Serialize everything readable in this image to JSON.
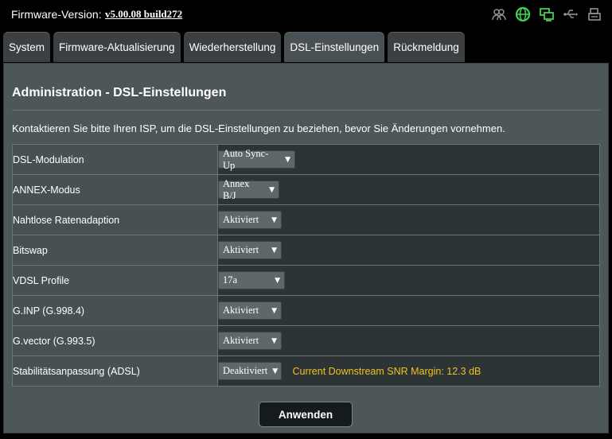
{
  "topbar": {
    "firmware_label": "Firmware-Version:",
    "firmware_version": "v5.00.08 build272",
    "icons": [
      "clients-icon",
      "internet-globe-icon",
      "network-status-icon",
      "usb-icon",
      "printer-icon"
    ],
    "active_icon_color": "#3ed04e"
  },
  "tabs": [
    {
      "label": "System"
    },
    {
      "label": "Firmware-Aktualisierung"
    },
    {
      "label": "Wiederherstellung"
    },
    {
      "label": "DSL-Einstellungen"
    },
    {
      "label": "Rückmeldung"
    }
  ],
  "active_tab": "DSL-Einstellungen",
  "panel": {
    "title": "Administration - DSL-Einstellungen",
    "description": "Kontaktieren Sie bitte Ihren ISP, um die DSL-Einstellungen zu beziehen, bevor Sie Änderungen vornehmen."
  },
  "settings": [
    {
      "label": "DSL-Modulation",
      "value": "Auto Sync-Up"
    },
    {
      "label": "ANNEX-Modus",
      "value": "Annex B/J"
    },
    {
      "label": "Nahtlose Ratenadaption",
      "value": "Aktiviert"
    },
    {
      "label": "Bitswap",
      "value": "Aktiviert"
    },
    {
      "label": "VDSL Profile",
      "value": "17a"
    },
    {
      "label": "G.INP (G.998.4)",
      "value": "Aktiviert"
    },
    {
      "label": "G.vector (G.993.5)",
      "value": "Aktiviert"
    },
    {
      "label": "Stabilitätsanpassung (ADSL)",
      "value": "Deaktiviert",
      "note": "Current Downstream SNR Margin: 12.3 dB"
    }
  ],
  "apply_button": "Anwenden",
  "colors": {
    "background": "#000000",
    "panel": "#4d5659",
    "label_cell": "#475154",
    "value_cell": "#2d3436",
    "snr_text": "#f2c01e"
  }
}
